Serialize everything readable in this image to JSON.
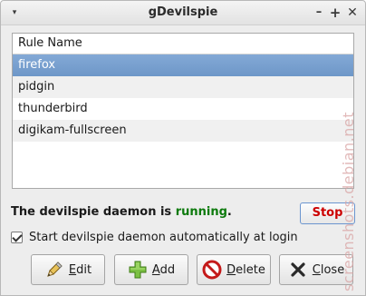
{
  "window": {
    "title": "gDevilspie",
    "menu_icon": "▾",
    "minimize_icon": "–",
    "maximize_icon": "+",
    "close_icon": "✕"
  },
  "rules_list": {
    "column_header": "Rule Name",
    "selected_index": 0,
    "rows": [
      {
        "name": "firefox"
      },
      {
        "name": "pidgin"
      },
      {
        "name": "thunderbird"
      },
      {
        "name": "digikam-fullscreen"
      }
    ]
  },
  "daemon": {
    "status_prefix": "The devilspie daemon is ",
    "status_value": "running",
    "status_suffix": ".",
    "status_color": "#0c7a0c",
    "stop_label": "Stop",
    "stop_color": "#cc0000"
  },
  "autostart": {
    "checked": true,
    "label": "Start devilspie daemon automatically at login"
  },
  "buttons": {
    "edit": {
      "mnemonic": "E",
      "rest": "dit",
      "icon": "pencil-icon"
    },
    "add": {
      "mnemonic": "A",
      "rest": "dd",
      "icon": "plus-icon"
    },
    "delete": {
      "mnemonic": "D",
      "rest": "elete",
      "icon": "no-entry-icon"
    },
    "close": {
      "mnemonic": "C",
      "rest": "lose",
      "icon": "x-icon"
    }
  },
  "watermark": {
    "text": "screenshots.debian.net"
  }
}
